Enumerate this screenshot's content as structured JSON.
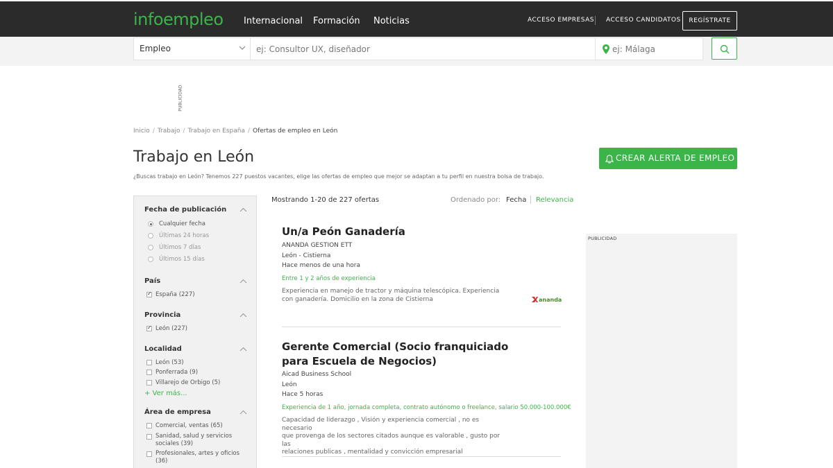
{
  "header": {
    "logo": "infoempleo",
    "main_links": [
      "Internacional",
      "Formación",
      "Noticias"
    ],
    "acceso_empresas": "ACCESO EMPRESAS",
    "acceso_candidatos": "ACCESO CANDIDATOS",
    "register": "REGÍSTRATE"
  },
  "search": {
    "category": "Empleo",
    "keyword_placeholder": "ej: Consultor UX, diseñador",
    "location_placeholder": "ej: Málaga"
  },
  "ad_label": "PUBLICIDAD",
  "breadcrumb": [
    "Inicio",
    "Trabajo",
    "Trabajo en España",
    "Ofertas de empleo en León"
  ],
  "page": {
    "title": "Trabajo en León",
    "description": "¿Buscas trabajo en León? Tenemos 227 puestos vacantes, elige las ofertas de empleo que mejor se adaptan a tu perfil en nuestra bolsa de trabajo.",
    "alert_button": "CREAR ALERTA DE EMPLEO"
  },
  "filters": {
    "fecha": {
      "title": "Fecha de publicación",
      "options": [
        "Cualquier fecha",
        "Últimas 24 horas",
        "Últimos 7 días",
        "Últimos 15 días"
      ],
      "selected_index": 0
    },
    "pais": {
      "title": "País",
      "options": [
        "España (227)"
      ]
    },
    "provincia": {
      "title": "Provincia",
      "options": [
        "León (227)"
      ]
    },
    "localidad": {
      "title": "Localidad",
      "options": [
        "León (53)",
        "Ponferrada (9)",
        "Villarejo de Orbigo (5)"
      ],
      "more": "+ Ver más..."
    },
    "area": {
      "title": "Área de empresa",
      "options": [
        "Comercial, ventas (65)",
        "Sanidad, salud y servicios",
        "sociales (39)",
        "Profesionales, artes y oficios",
        "(36)"
      ]
    }
  },
  "results": {
    "count": "Mostrando 1-20 de 227 ofertas",
    "order_label": "Ordenado por:",
    "order_fecha": "Fecha",
    "order_relevancia": "Relevancia"
  },
  "jobs": [
    {
      "title": "Un/a Peón Ganadería",
      "company": "ANANDA GESTION ETT",
      "location": "León - Cistierna",
      "posted": "Hace menos de una hora",
      "experience": "Entre 1 y 2 años de experiencia",
      "description": [
        "Experiencia en manejo de tractor y máquina telescópica. Experiencia",
        "con ganadería. Domicilio en la zona de Cistierna"
      ],
      "logo_text": "ananda"
    },
    {
      "title": [
        "Gerente Comercial (Socio franquiciado",
        "para Escuela de Negocios)"
      ],
      "company": "Aicad Business School",
      "location": "León",
      "posted": "Hace 5 horas",
      "experience": "Experiencia de 1 año, jornada completa, contrato autónomo o freelance, salario 50.000-100.000€",
      "description": [
        "Capacidad de liderazgo , Visión y experiencia comercial , no es necesario",
        "que provenga de los sectores citados aunque es valorable , gusto por las",
        "relaciones publicas , mentalidad y convicción empresarial"
      ]
    }
  ],
  "colors": {
    "brand_green": "#3cb44a",
    "nav_bg": "#2b2b2b"
  },
  "icons": [
    "chevron-down-icon",
    "map-pin-icon",
    "search-icon",
    "bell-icon",
    "chevron-up-icon"
  ]
}
